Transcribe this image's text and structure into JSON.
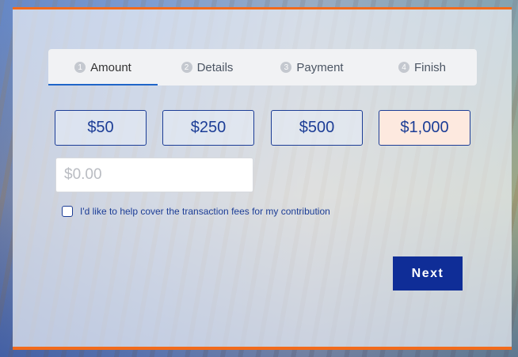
{
  "steps": [
    {
      "num": "1",
      "label": "Amount"
    },
    {
      "num": "2",
      "label": "Details"
    },
    {
      "num": "3",
      "label": "Payment"
    },
    {
      "num": "4",
      "label": "Finish"
    }
  ],
  "active_step": "Amount",
  "amounts": [
    {
      "label": "$50"
    },
    {
      "label": "$250"
    },
    {
      "label": "$500"
    },
    {
      "label": "$1,000",
      "selected": true
    }
  ],
  "custom_amount": {
    "value": "",
    "placeholder": "$0.00"
  },
  "fee_checkbox": {
    "label": "I'd like to help cover the transaction fees for my contribution",
    "checked": false
  },
  "next_button": {
    "label": "Next"
  },
  "colors": {
    "accent_orange": "#f26a1b",
    "primary_blue": "#0f2d97",
    "selected_fill": "#fde9df"
  }
}
